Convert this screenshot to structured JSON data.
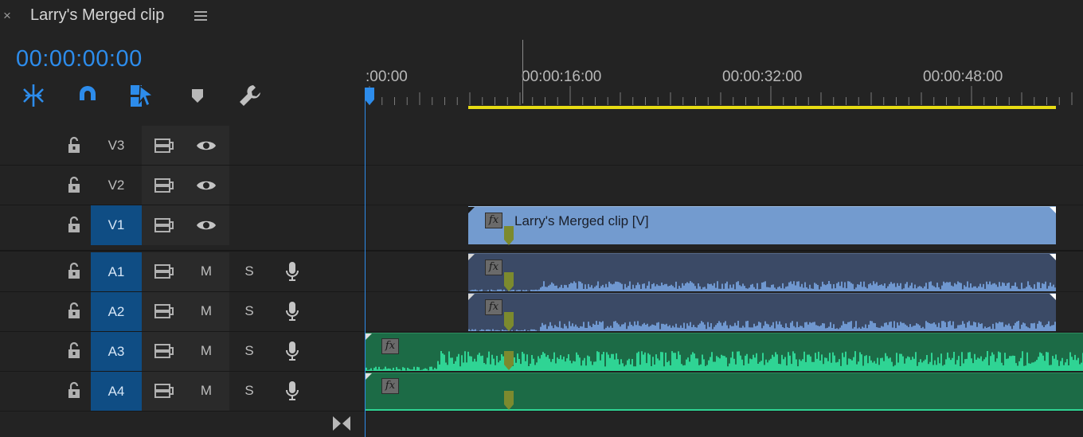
{
  "header": {
    "close_glyph": "×",
    "title": "Larry's Merged clip",
    "menu_icon": "hamburger-menu-icon"
  },
  "timecode": "00:00:00:00",
  "toolbar": {
    "icons": [
      "insert-overwrite-nest-icon",
      "snap-magnet-icon",
      "linked-selection-icon",
      "add-marker-icon",
      "wrench-settings-icon"
    ]
  },
  "ruler": {
    "labels": [
      ":00:00",
      "00:00:16:00",
      "00:00:32:00",
      "00:00:48:00"
    ]
  },
  "tracks": {
    "video": [
      {
        "name": "V3",
        "active": false
      },
      {
        "name": "V2",
        "active": false
      },
      {
        "name": "V1",
        "active": true
      }
    ],
    "audio": [
      {
        "name": "A1",
        "active": true,
        "mute": "M",
        "solo": "S"
      },
      {
        "name": "A2",
        "active": true,
        "mute": "M",
        "solo": "S"
      },
      {
        "name": "A3",
        "active": true,
        "mute": "M",
        "solo": "S"
      },
      {
        "name": "A4",
        "active": true,
        "mute": "M",
        "solo": "S"
      }
    ]
  },
  "clips": {
    "v1_label": "Larry's Merged clip [V]",
    "fx": "fx"
  },
  "colors": {
    "accent": "#2d8ceb",
    "track_active": "#0f4d84",
    "video_clip": "#739bcf",
    "audio_clip_linked": "#3b4a66",
    "audio_clip_green": "#1c6b46",
    "work_area": "#e8dc14"
  }
}
